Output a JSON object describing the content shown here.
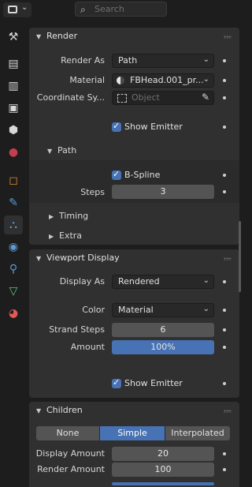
{
  "topbar": {
    "search_placeholder": "Search"
  },
  "sidebar": {
    "tabs": [
      {
        "name": "tool-icon",
        "glyph": "⚒",
        "color": "#d8d8d8"
      },
      {
        "name": "render-icon",
        "glyph": "📷",
        "color": "#d8d8d8"
      },
      {
        "name": "output-icon",
        "glyph": "🖶",
        "color": "#d8d8d8"
      },
      {
        "name": "view-layer-icon",
        "glyph": "▣",
        "color": "#d8d8d8"
      },
      {
        "name": "scene-icon",
        "glyph": "⬢",
        "color": "#d8d8d8"
      },
      {
        "name": "world-icon",
        "glyph": "●",
        "color": "#c0404e"
      },
      {
        "name": "object-icon",
        "glyph": "◻",
        "color": "#e08a2a"
      },
      {
        "name": "modifier-icon",
        "glyph": "🔧",
        "color": "#5b9bd5"
      },
      {
        "name": "particles-icon",
        "glyph": "⛬",
        "color": "#5b9bd5"
      },
      {
        "name": "physics-icon",
        "glyph": "◉",
        "color": "#5b9bd5"
      },
      {
        "name": "constraints-icon",
        "glyph": "⚲",
        "color": "#5b9bd5"
      },
      {
        "name": "data-icon",
        "glyph": "▽",
        "color": "#5dc47a"
      },
      {
        "name": "material-icon",
        "glyph": "◕",
        "color": "#e05a5a"
      }
    ]
  },
  "render": {
    "title": "Render",
    "render_as_label": "Render As",
    "render_as_value": "Path",
    "material_label": "Material",
    "material_value": "FBHead.001_pr...",
    "coord_label": "Coordinate Sy...",
    "coord_placeholder": "Object",
    "show_emitter": "Show Emitter",
    "path": {
      "title": "Path",
      "bspline": "B-Spline",
      "steps_label": "Steps",
      "steps_value": "3"
    },
    "timing_title": "Timing",
    "extra_title": "Extra"
  },
  "viewport": {
    "title": "Viewport Display",
    "display_as_label": "Display As",
    "display_as_value": "Rendered",
    "color_label": "Color",
    "color_value": "Material",
    "strand_steps_label": "Strand Steps",
    "strand_steps_value": "6",
    "amount_label": "Amount",
    "amount_value": "100%",
    "amount_fraction": 1.0,
    "show_emitter": "Show Emitter"
  },
  "children": {
    "title": "Children",
    "options": [
      "None",
      "Simple",
      "Interpolated"
    ],
    "selected": "Simple",
    "display_amount_label": "Display Amount",
    "display_amount_value": "20",
    "render_amount_label": "Render Amount",
    "render_amount_value": "100"
  },
  "colors": {
    "accent": "#4772b3",
    "panel": "#303030",
    "background": "#1d1d1d"
  }
}
